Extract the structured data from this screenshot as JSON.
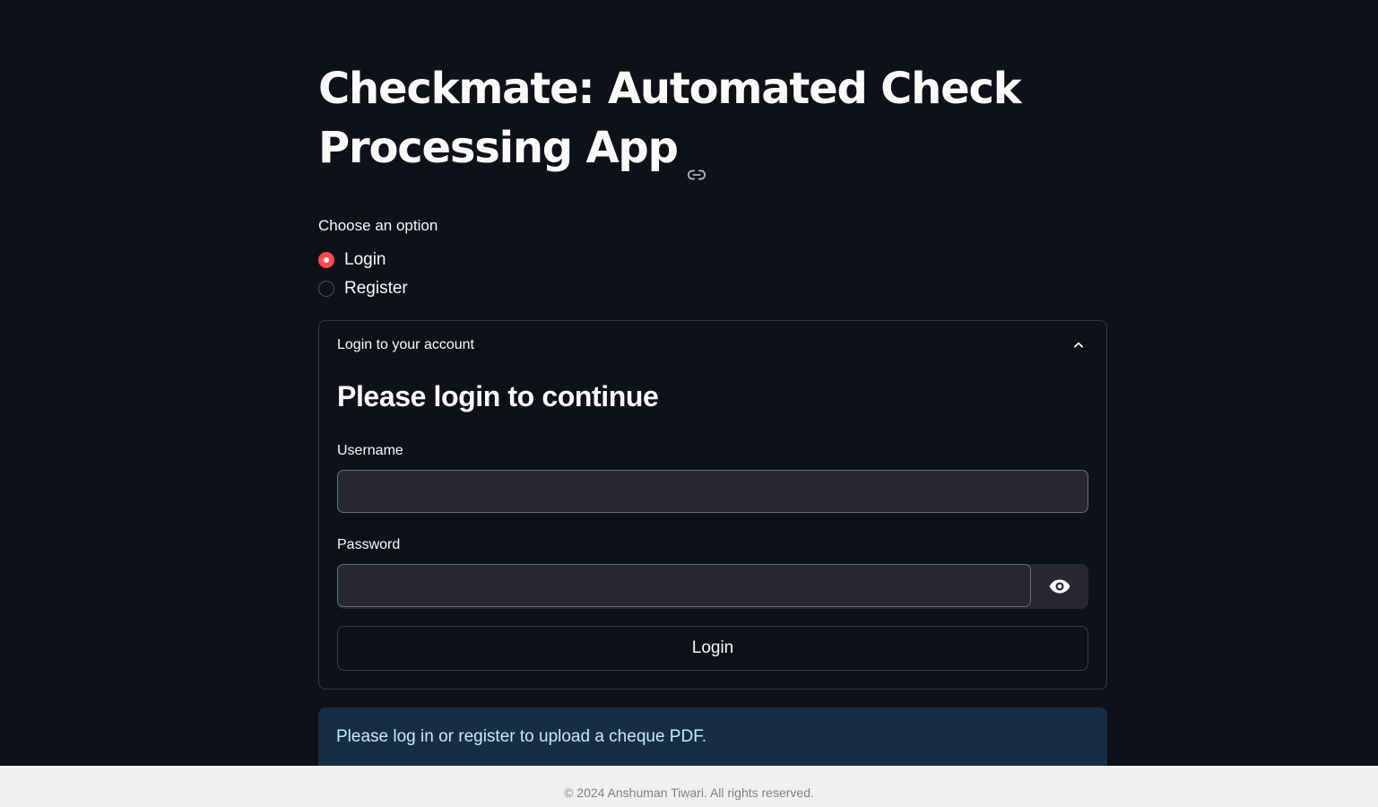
{
  "app": {
    "title": "Checkmate: Automated Check Processing App"
  },
  "mode_selector": {
    "label": "Choose an option",
    "options": [
      {
        "label": "Login",
        "selected": true
      },
      {
        "label": "Register",
        "selected": false
      }
    ]
  },
  "login_expander": {
    "header": "Login to your account",
    "expanded": true,
    "heading": "Please login to continue",
    "username": {
      "label": "Username",
      "value": "",
      "placeholder": ""
    },
    "password": {
      "label": "Password",
      "value": "",
      "placeholder": ""
    },
    "submit_label": "Login"
  },
  "info": {
    "message": "Please log in or register to upload a cheque PDF."
  },
  "footer": {
    "text": "© 2024 Anshuman Tiwari. All rights reserved."
  },
  "colors": {
    "background": "#0e1117",
    "accent": "#ff4b4b",
    "input_bg": "#262730",
    "info_bg": "#172d43",
    "info_text": "#c7ebff",
    "footer_bg": "#f0f0f0"
  },
  "icons": {
    "title_anchor": "link-icon",
    "expander_toggle": "chevron-up-icon",
    "password_toggle": "eye-icon"
  }
}
